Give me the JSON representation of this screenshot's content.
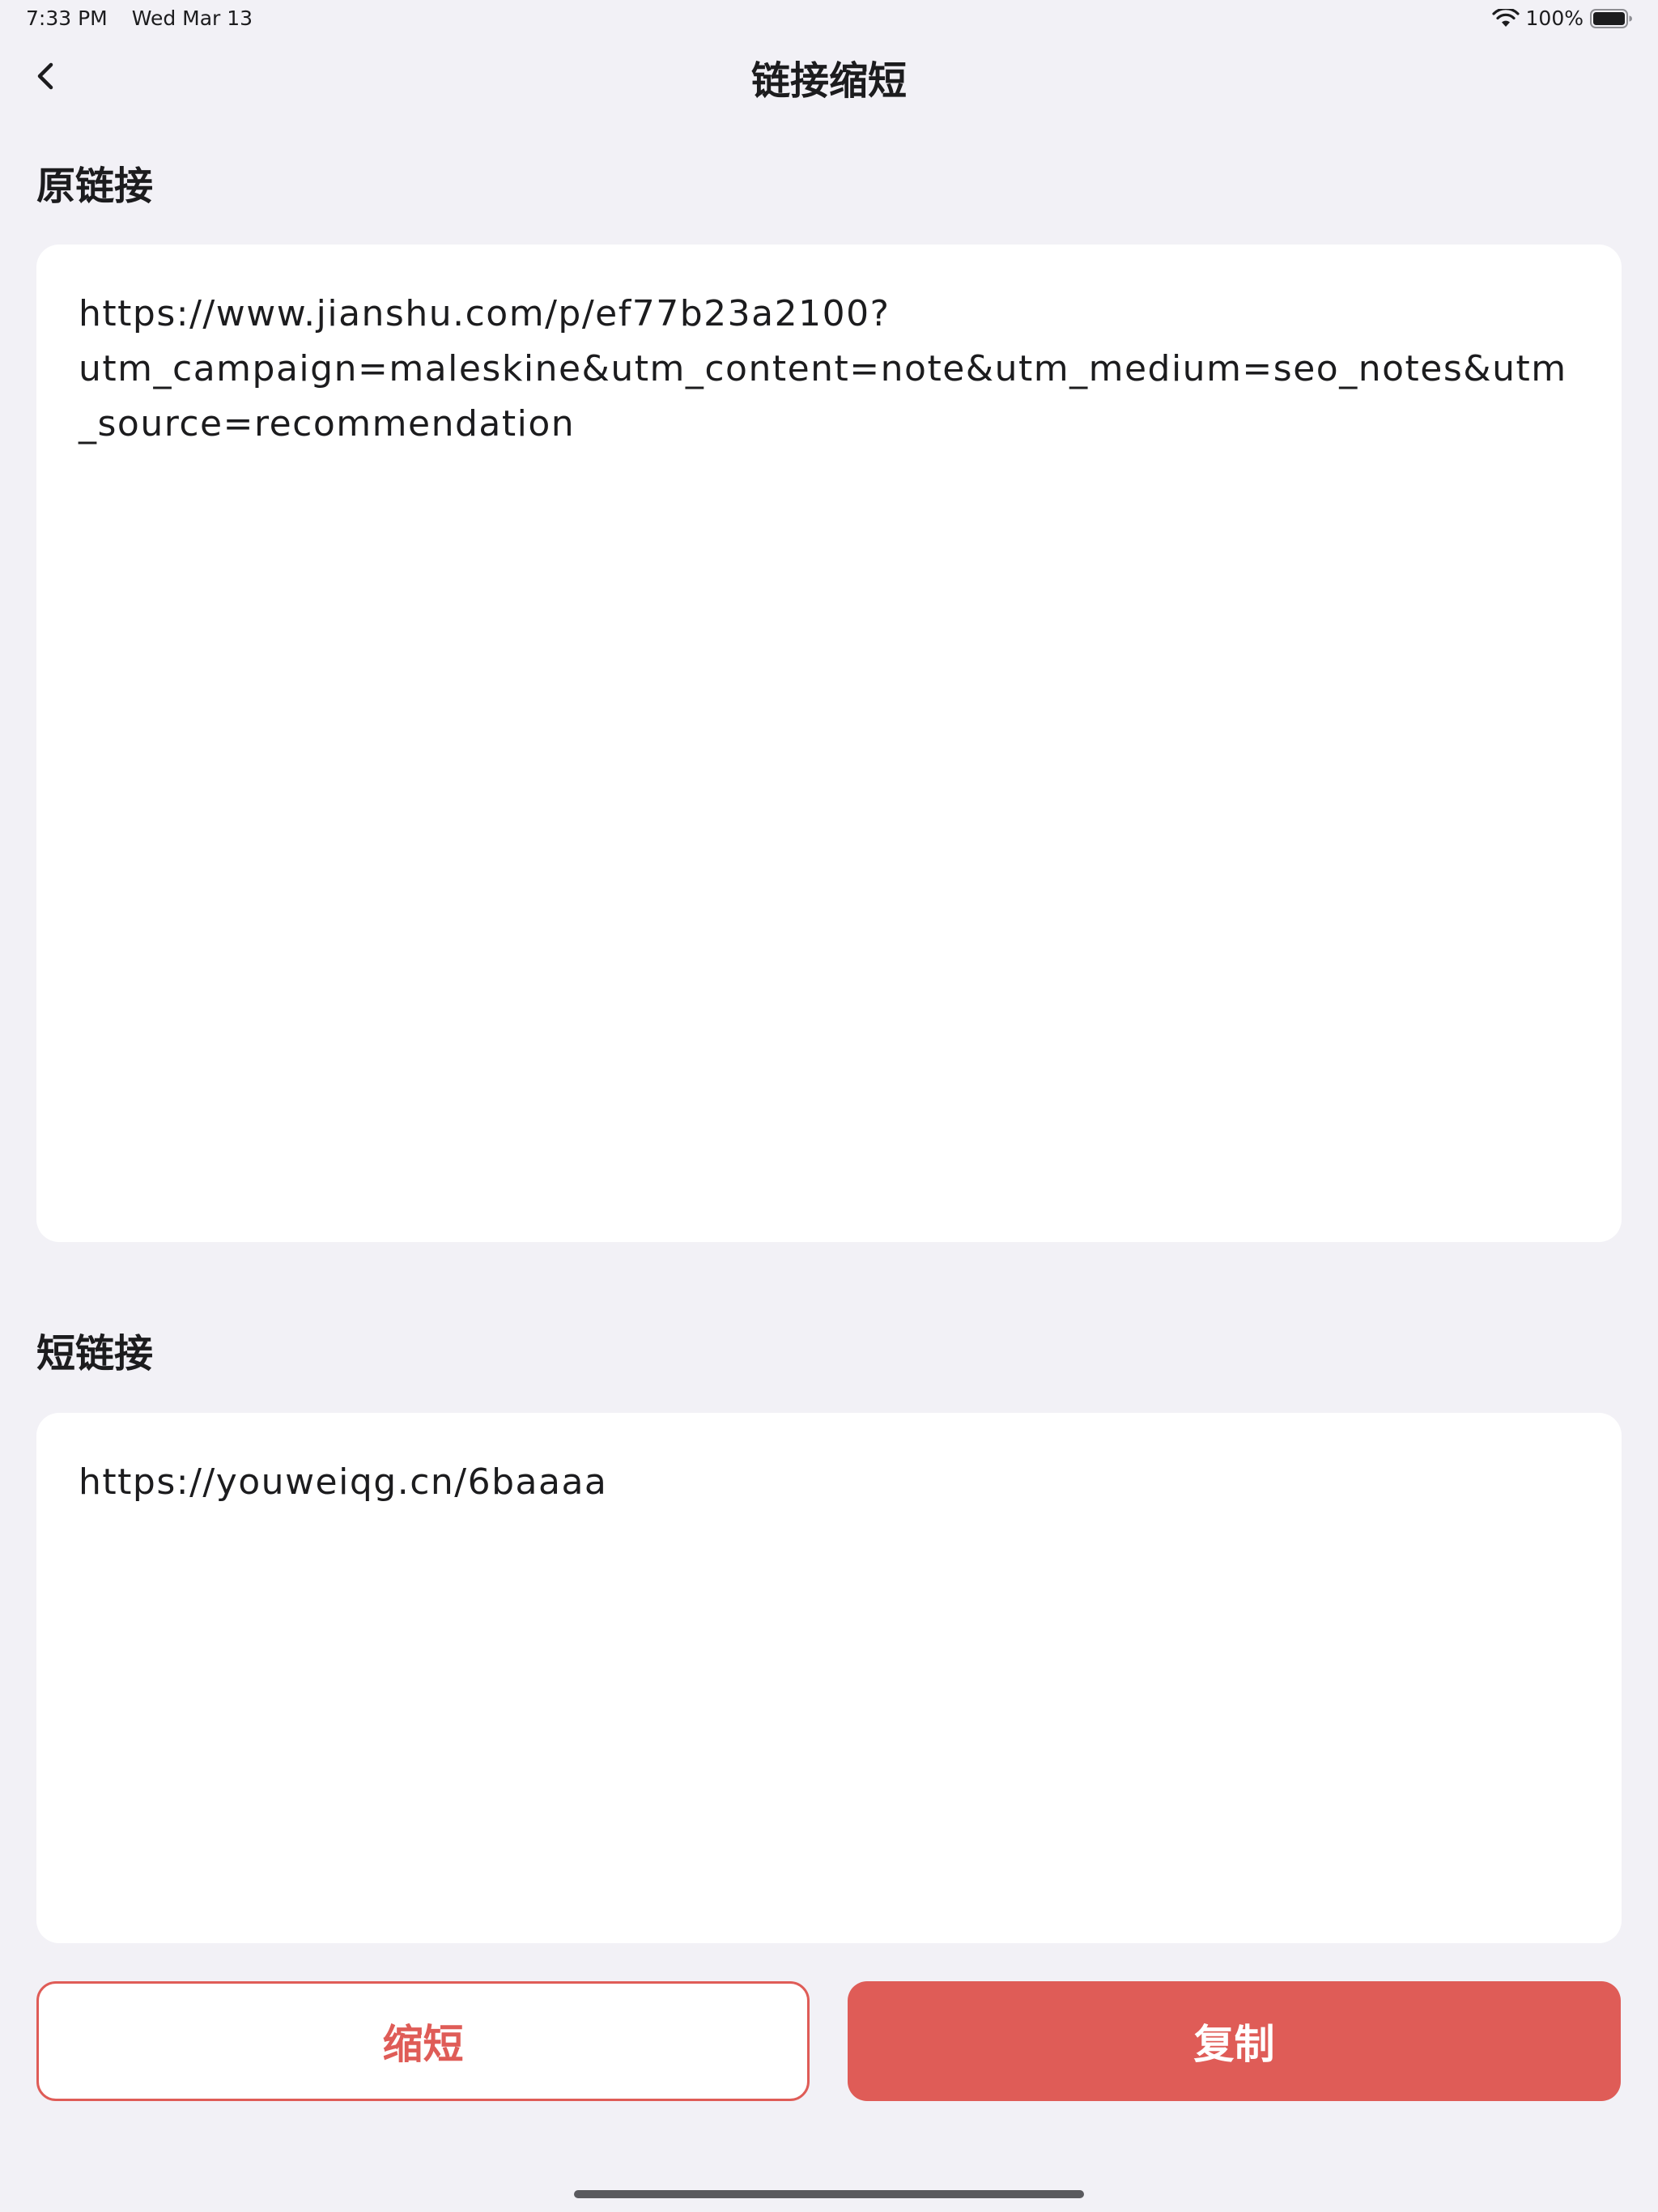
{
  "status_bar": {
    "time": "7:33 PM",
    "date": "Wed Mar 13",
    "battery": "100%"
  },
  "nav": {
    "title": "链接缩短",
    "back_icon": "chevron-left-icon"
  },
  "original": {
    "label": "原链接",
    "value": "https://www.jianshu.com/p/ef77b23a2100?\nutm_campaign=maleskine&utm_content=note&utm_medium=seo_notes&utm_source=recommendation"
  },
  "short": {
    "label": "短链接",
    "value": "https://youweiqg.cn/6baaaa"
  },
  "actions": {
    "shorten_label": "缩短",
    "copy_label": "复制"
  },
  "colors": {
    "accent": "#df5c57",
    "background": "#f2f1f6",
    "card": "#ffffff"
  }
}
